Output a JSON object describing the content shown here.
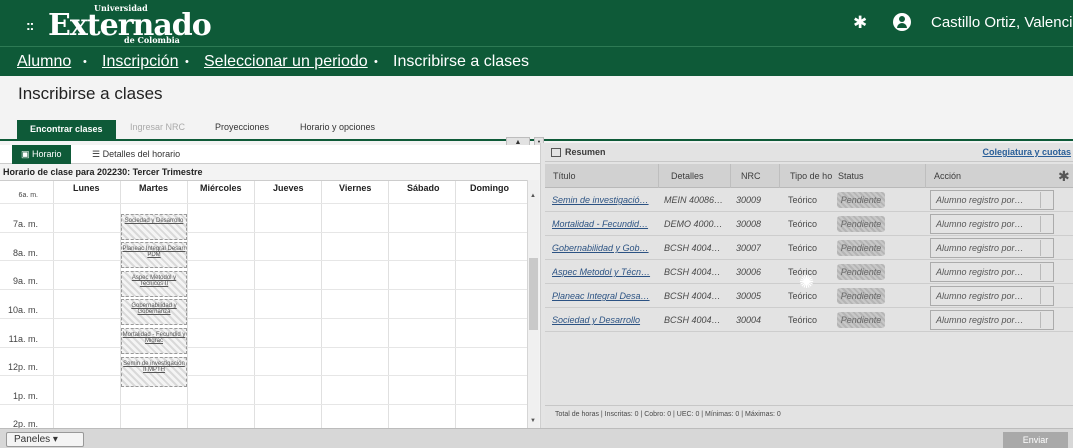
{
  "header": {
    "logo_top": "Universidad",
    "logo_main": "Externado",
    "logo_sub": "de Colombia",
    "user_name": "Castillo Ortiz, Valenciano"
  },
  "breadcrumb": {
    "items": [
      "Alumno",
      "Inscripción",
      "Seleccionar un periodo",
      "Inscribirse a clases"
    ],
    "separator": "•"
  },
  "page_title": "Inscribirse a clases",
  "tabs": [
    "Encontrar clases",
    "Ingresar NRC",
    "Proyecciones",
    "Horario y opciones"
  ],
  "left_panel": {
    "subtabs": [
      "Horario",
      "Detalles del horario"
    ],
    "calendar_title": "Horario de clase para 202230: Tercer Trimestre",
    "days": [
      "Lunes",
      "Martes",
      "Miércoles",
      "Jueves",
      "Viernes",
      "Sábado",
      "Domingo"
    ],
    "times": [
      "6a. m.",
      "7a. m.",
      "8a. m.",
      "9a. m.",
      "10a. m.",
      "11a. m.",
      "12p. m.",
      "1p. m.",
      "2p. m."
    ],
    "events": [
      "Sociedad y Desarrollo",
      "Planeac Integral Desarr PDM",
      "Aspec Metodol y Tecnicos II",
      "Gobernabilidad y Gobernanza",
      "Mortalidad - Fecundid y Migrac",
      "Semin de investigación II MPTH"
    ]
  },
  "right_panel": {
    "title": "Resumen",
    "link": "Colegiatura y cuotas",
    "columns": [
      "Título",
      "Detalles",
      "NRC",
      "Tipo de ho",
      "Status",
      "Acción"
    ],
    "rows": [
      {
        "titulo": "Semin de investigació…",
        "detalles": "MEIN 40086…",
        "nrc": "30009",
        "tipo": "Teórico",
        "status": "Pendiente",
        "accion": "Alumno registro por…"
      },
      {
        "titulo": "Mortalidad - Fecundid…",
        "detalles": "DEMO 4000…",
        "nrc": "30008",
        "tipo": "Teórico",
        "status": "Pendiente",
        "accion": "Alumno registro por…"
      },
      {
        "titulo": "Gobernabilidad y Gob…",
        "detalles": "BCSH 4004…",
        "nrc": "30007",
        "tipo": "Teórico",
        "status": "Pendiente",
        "accion": "Alumno registro por…"
      },
      {
        "titulo": "Aspec Metodol y Técn…",
        "detalles": "BCSH 4004…",
        "nrc": "30006",
        "tipo": "Teórico",
        "status": "Pendiente",
        "accion": "Alumno registro por…"
      },
      {
        "titulo": "Planeac Integral Desa…",
        "detalles": "BCSH 4004…",
        "nrc": "30005",
        "tipo": "Teórico",
        "status": "Pendiente",
        "accion": "Alumno registro por…"
      },
      {
        "titulo": "Sociedad y Desarrollo",
        "detalles": "BCSH 4004…",
        "nrc": "30004",
        "tipo": "Teórico",
        "status": "Pendiente",
        "accion": "Alumno registro por…"
      }
    ],
    "totals": "Total de horas | Inscritas: 0 | Cobro: 0 | UEC: 0 | Mínimas: 0 | Máximas: 0"
  },
  "bottom": {
    "panels_label": "Paneles",
    "submit_label": "Enviar"
  },
  "colors": {
    "brand_green": "#0e5a38",
    "link_blue": "#1e5fa5"
  }
}
